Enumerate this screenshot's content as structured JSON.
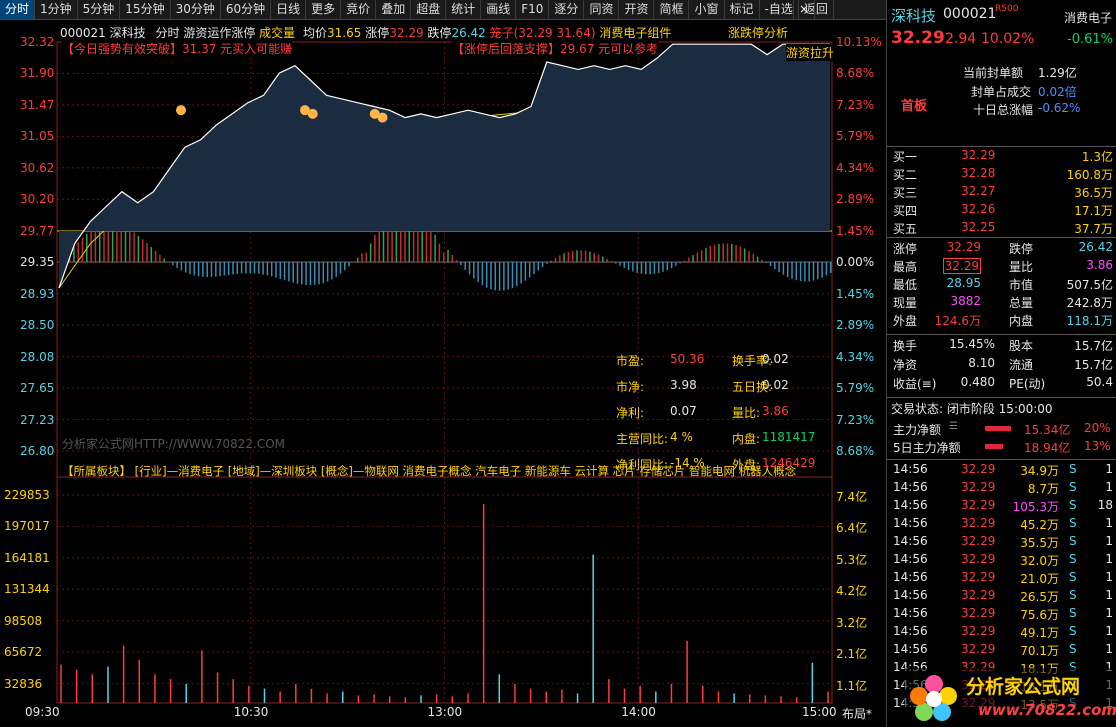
{
  "toolbar": {
    "items": [
      "分时",
      "1分钟",
      "5分钟",
      "15分钟",
      "30分钟",
      "60分钟",
      "日线",
      "更多",
      "竞价",
      "叠加",
      "超盘",
      "统计",
      "画线",
      "F10",
      "逐分",
      "同资",
      "开资",
      "简框",
      "小窗",
      "标记",
      "-自选",
      "返回"
    ],
    "close": "×",
    "active_index": 0
  },
  "header": {
    "code": "000021",
    "name": "深科技",
    "mode": "分时",
    "indicator": "游资运作涨停",
    "vol_label": "成交量",
    "avg_label": "均价",
    "avg_value": "31.65",
    "limit_up_label": "涨停",
    "limit_up_value": "32.29",
    "limit_down_label": "跌停",
    "limit_down_value": "26.42",
    "cage_text": "笼子(32.29 31.64)",
    "sector": "消费电子组件",
    "rank_btn": "涨跌停分析"
  },
  "price_axis": {
    "left": [
      "32.32",
      "31.90",
      "31.47",
      "31.05",
      "30.62",
      "30.20",
      "29.77",
      "29.35",
      "28.93",
      "28.50",
      "28.08",
      "27.65",
      "27.23",
      "26.80"
    ],
    "right": [
      "10.13%",
      "8.68%",
      "7.23%",
      "5.79%",
      "4.34%",
      "2.89%",
      "1.45%",
      "0.00%",
      "1.45%",
      "2.89%",
      "4.34%",
      "5.79%",
      "7.23%",
      "8.68%"
    ]
  },
  "volume_axis": {
    "left": [
      "229853",
      "197017",
      "164181",
      "131344",
      "98508",
      "65672",
      "32836"
    ],
    "right": [
      "7.4亿",
      "6.4亿",
      "5.3亿",
      "4.2亿",
      "3.2亿",
      "2.1亿",
      "1.1亿"
    ]
  },
  "time_axis": [
    "09:30",
    "10:30",
    "13:00",
    "14:00",
    "15:00"
  ],
  "layout_btn": "布局*",
  "annotations": {
    "breakout": "【今日强势有效突破】31.37 元买入可能赚",
    "limit_note": "【涨停后回落支撑】29.67 元可以参考",
    "youzi": "游资拉升",
    "watermark": "分析家公式网HTTP://WWW.70822.COM",
    "sectors": "【所属板块】 [行业]—消费电子 [地域]—深圳板块 [概念]—物联网 消费电子概念 汽车电子 新能源车 云计算 芯片 存储芯片 智能电网 机器人概念"
  },
  "fundamentals": {
    "pe_label": "市盈:",
    "pe_value": "50.36",
    "turnover_label": "换手率:",
    "turnover_value": "0.02",
    "pb_label": "市净:",
    "pb_value": "3.98",
    "five_day_label": "五日换:",
    "five_day_value": "0.02",
    "profit_label": "净利:",
    "profit_value": "0.07",
    "vol_ratio_label": "量比:",
    "vol_ratio_value": "3.86",
    "revenue_label": "主营同比:",
    "revenue_value": "4 %",
    "inner_label": "内盘:",
    "inner_value": "1181417",
    "netprofit_label": "净利同比:",
    "netprofit_value": "-14 %",
    "outer_label": "外盘:",
    "outer_value": "1246429"
  },
  "panel": {
    "name": "深科技",
    "code": "000021",
    "r_tag": "R500",
    "sector_tag": "消费电子",
    "price": "32.29",
    "change": "2.94",
    "change_pct": "10.02%",
    "sector_pct": "-0.61%",
    "first_board": "首板",
    "seal_label": "当前封单额",
    "seal_value": "1.29亿",
    "seal_deal_label": "封单占成交",
    "seal_deal_value": "0.02倍",
    "ten_day_label": "十日总涨幅",
    "ten_day_value": "-0.62%",
    "bids": [
      {
        "label": "买一",
        "price": "32.29",
        "vol": "1.3亿"
      },
      {
        "label": "买二",
        "price": "32.28",
        "vol": "160.8万"
      },
      {
        "label": "买三",
        "price": "32.27",
        "vol": "36.5万"
      },
      {
        "label": "买四",
        "price": "32.26",
        "vol": "17.1万"
      },
      {
        "label": "买五",
        "price": "32.25",
        "vol": "37.7万"
      }
    ],
    "stats": [
      {
        "l1": "涨停",
        "v1": "32.29",
        "l2": "跌停",
        "v2": "26.42"
      },
      {
        "l1": "最高",
        "v1": "32.29",
        "l2": "量比",
        "v2": "3.86"
      },
      {
        "l1": "最低",
        "v1": "28.95",
        "l2": "市值",
        "v2": "507.5亿"
      },
      {
        "l1": "现量",
        "v1": "3882",
        "l2": "总量",
        "v2": "242.8万"
      },
      {
        "l1": "外盘",
        "v1": "124.6万",
        "l2": "内盘",
        "v2": "118.1万"
      }
    ],
    "stats2": [
      {
        "l1": "换手",
        "v1": "15.45%",
        "l2": "股本",
        "v2": "15.7亿"
      },
      {
        "l1": "净资",
        "v1": "8.10",
        "l2": "流通",
        "v2": "15.7亿"
      },
      {
        "l1": "收益(≡)",
        "v1": "0.480",
        "l2": "PE(动)",
        "v2": "50.4"
      }
    ],
    "trade_status": "交易状态: 闭市阶段 15:00:00",
    "main_net_label": "主力净额",
    "main_net_value": "15.34亿",
    "main_net_pct": "20%",
    "five_day_net_label": "5日主力净额",
    "five_day_net_value": "18.94亿",
    "five_day_net_pct": "13%",
    "ticks": [
      {
        "t": "14:56",
        "p": "32.29",
        "v": "34.9万",
        "d": "S",
        "n": "1"
      },
      {
        "t": "14:56",
        "p": "32.29",
        "v": "8.7万",
        "d": "S",
        "n": "1"
      },
      {
        "t": "14:56",
        "p": "32.29",
        "v": "105.3万",
        "d": "S",
        "n": "18"
      },
      {
        "t": "14:56",
        "p": "32.29",
        "v": "45.2万",
        "d": "S",
        "n": "1"
      },
      {
        "t": "14:56",
        "p": "32.29",
        "v": "35.5万",
        "d": "S",
        "n": "1"
      },
      {
        "t": "14:56",
        "p": "32.29",
        "v": "32.0万",
        "d": "S",
        "n": "1"
      },
      {
        "t": "14:56",
        "p": "32.29",
        "v": "21.0万",
        "d": "S",
        "n": "1"
      },
      {
        "t": "14:56",
        "p": "32.29",
        "v": "26.5万",
        "d": "S",
        "n": "1"
      },
      {
        "t": "14:56",
        "p": "32.29",
        "v": "75.6万",
        "d": "S",
        "n": "1"
      },
      {
        "t": "14:56",
        "p": "32.29",
        "v": "49.1万",
        "d": "S",
        "n": "1"
      },
      {
        "t": "14:56",
        "p": "32.29",
        "v": "70.1万",
        "d": "S",
        "n": "1"
      },
      {
        "t": "14:56",
        "p": "32.29",
        "v": "18.1万",
        "d": "S",
        "n": "1"
      },
      {
        "t": "14:56",
        "p": "32.29",
        "v": "16.1万",
        "d": "S",
        "n": "1"
      },
      {
        "t": "14:56",
        "p": "32.29",
        "v": "13.5万",
        "d": "S",
        "n": "1"
      }
    ],
    "logo_text": "分析家公式网",
    "logo_url": "www.70822.com"
  },
  "colors": {
    "up": "#ff3b3b",
    "down": "#00d26a",
    "avg": "#e6d200",
    "price": "#ffffff",
    "grid": "#6b1c1c",
    "cyan": "#52d5e8"
  },
  "chart_data": {
    "type": "line",
    "title": "000021 深科技 分时",
    "x_ticks": [
      "09:30",
      "10:30",
      "13:00",
      "14:00",
      "15:00"
    ],
    "prev_close": 29.35,
    "limit_up": 32.29,
    "limit_down": 26.42,
    "ylim": [
      26.8,
      32.32
    ],
    "price_series": [
      29.0,
      29.6,
      29.9,
      30.1,
      30.3,
      30.15,
      30.3,
      30.6,
      30.9,
      31.0,
      31.2,
      31.35,
      31.5,
      31.6,
      31.9,
      32.0,
      31.8,
      31.6,
      31.55,
      31.5,
      31.45,
      31.4,
      31.3,
      31.35,
      31.3,
      31.35,
      31.4,
      31.35,
      31.3,
      31.35,
      31.45,
      32.05,
      32.0,
      31.95,
      32.0,
      31.95,
      32.0,
      31.95,
      32.1,
      32.29,
      32.29,
      32.29,
      32.29,
      32.29,
      32.29,
      32.15,
      32.29,
      32.29,
      32.29,
      32.29
    ],
    "avg_series": [
      29.0,
      29.3,
      29.6,
      29.8,
      30.0,
      30.1,
      30.2,
      30.35,
      30.5,
      30.6,
      30.7,
      30.8,
      30.9,
      30.95,
      31.0,
      31.05,
      31.1,
      31.12,
      31.14,
      31.16,
      31.18,
      31.2,
      31.22,
      31.24,
      31.26,
      31.28,
      31.3,
      31.32,
      31.34,
      31.36,
      31.38,
      31.42,
      31.45,
      31.47,
      31.5,
      31.52,
      31.54,
      31.56,
      31.57,
      31.58,
      31.59,
      31.6,
      31.61,
      31.62,
      31.62,
      31.63,
      31.64,
      31.64,
      31.65,
      31.65
    ],
    "volume": {
      "type": "bar",
      "ylim": [
        0,
        229853
      ],
      "values": [
        40000,
        35000,
        30000,
        38000,
        60000,
        45000,
        30000,
        25000,
        20000,
        55000,
        32000,
        25000,
        18000,
        15000,
        12000,
        20000,
        15000,
        10000,
        12000,
        8000,
        9000,
        7000,
        6000,
        8000,
        9000,
        7000,
        10000,
        208000,
        30000,
        20000,
        15000,
        12000,
        14000,
        10000,
        155000,
        25000,
        15000,
        18000,
        12000,
        20000,
        65000,
        18000,
        12000,
        10000,
        9000,
        8000,
        7000,
        6000,
        42000,
        12000
      ]
    }
  }
}
